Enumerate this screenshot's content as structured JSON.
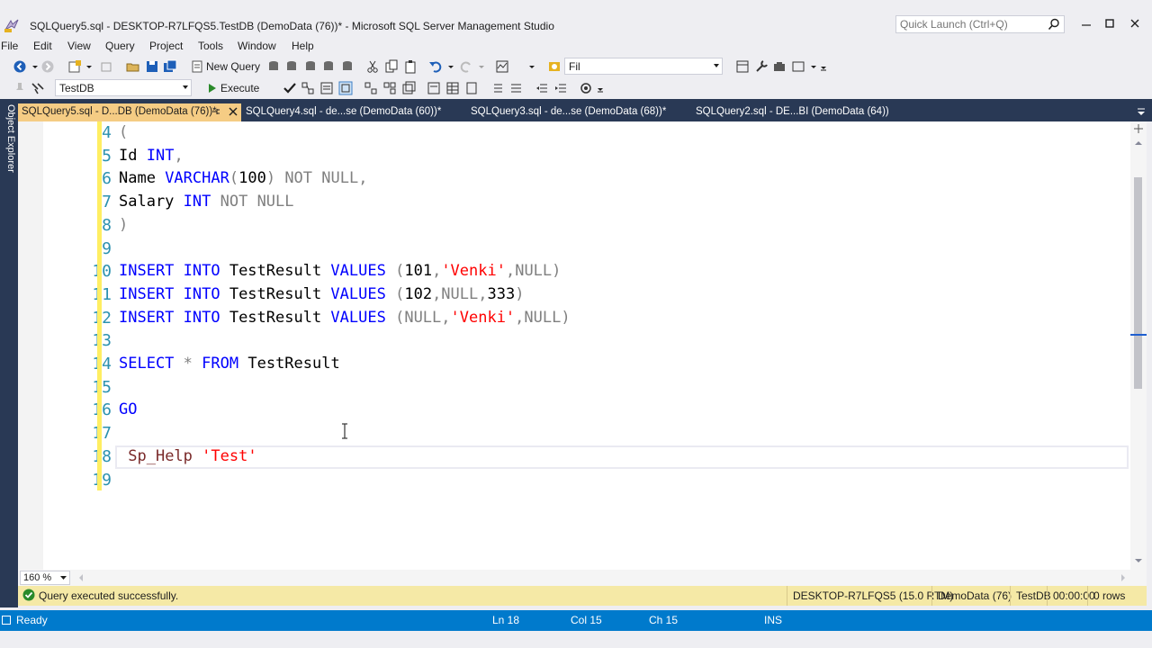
{
  "window": {
    "title": "SQLQuery5.sql - DESKTOP-R7LFQS5.TestDB (DemoData (76))* - Microsoft SQL Server Management Studio",
    "quick_launch_placeholder": "Quick Launch (Ctrl+Q)"
  },
  "menu": [
    "File",
    "Edit",
    "View",
    "Query",
    "Project",
    "Tools",
    "Window",
    "Help"
  ],
  "toolbar1": {
    "new_query_label": "New Query",
    "find_combo_value": "Fil"
  },
  "toolbar2": {
    "database_value": "TestDB",
    "execute_label": "Execute"
  },
  "side_panel": {
    "object_explorer_label": "Object Explorer"
  },
  "tabs": [
    {
      "label": "SQLQuery5.sql - D...DB (DemoData (76))*",
      "active": true
    },
    {
      "label": "SQLQuery4.sql - de...se (DemoData (60))*",
      "active": false
    },
    {
      "label": "SQLQuery3.sql - de...se (DemoData (68))*",
      "active": false
    },
    {
      "label": "SQLQuery2.sql - DE...BI (DemoData (64))",
      "active": false
    }
  ],
  "editor": {
    "line_numbers": [
      "4",
      "5",
      "6",
      "7",
      "8",
      "9",
      "10",
      "11",
      "12",
      "13",
      "14",
      "15",
      "16",
      "17",
      "18",
      "19"
    ],
    "current_line": 18
  },
  "zoom": {
    "value": "160 %"
  },
  "query_status": {
    "message": "Query executed successfully.",
    "server": "DESKTOP-R7LFQS5 (15.0 RTM)",
    "login": "DemoData (76)",
    "database": "TestDB",
    "elapsed": "00:00:00",
    "rows": "0 rows"
  },
  "status_bar": {
    "state": "Ready",
    "line": "Ln 18",
    "column": "Col 15",
    "char": "Ch 15",
    "mode": "INS"
  },
  "colors": {
    "status_blue": "#007acc",
    "tab_active": "#f5cc84",
    "query_status_bg": "#f5e9a6",
    "keyword": "#0000ff",
    "string": "#ff0000",
    "line_number": "#2b91af"
  }
}
